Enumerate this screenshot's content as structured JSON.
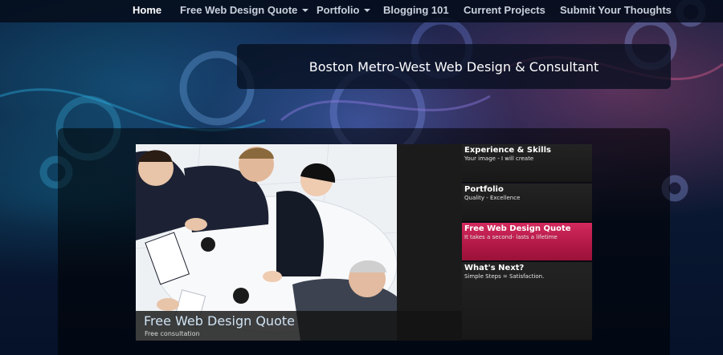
{
  "nav": {
    "items": [
      {
        "label": "Home"
      },
      {
        "label": "Free Web Design Quote"
      },
      {
        "label": "Portfolio"
      },
      {
        "label": "Blogging 101"
      },
      {
        "label": "Current Projects"
      },
      {
        "label": "Submit Your Thoughts"
      }
    ]
  },
  "banner": {
    "title": "Boston Metro-West Web Design & Consultant"
  },
  "slider": {
    "caption_title": "Free Web Design Quote",
    "caption_subtitle": "Free consultation",
    "image_subject": "business-meeting-photo"
  },
  "tabs": [
    {
      "title": "Experience & Skills",
      "subtitle": "Your image - I will create"
    },
    {
      "title": "Portfolio",
      "subtitle": "Quality - Excellence"
    },
    {
      "title": "Free Web Design Quote",
      "subtitle": "It takes a second- lasts a lifetime"
    },
    {
      "title": "What's Next?",
      "subtitle": "Simple Steps = Satisfaction."
    }
  ],
  "colors": {
    "accent": "#c21f50",
    "nav_text": "#c9d1dc",
    "caption_title": "#cfe3f2"
  }
}
